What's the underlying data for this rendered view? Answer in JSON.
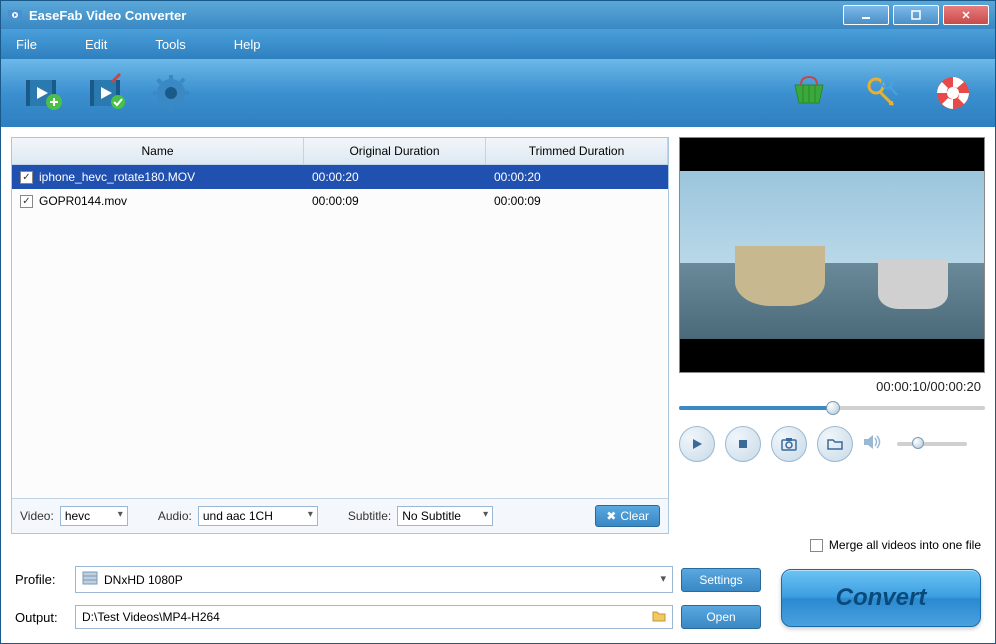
{
  "window": {
    "title": "EaseFab Video Converter"
  },
  "menu": {
    "items": [
      "File",
      "Edit",
      "Tools",
      "Help"
    ]
  },
  "table": {
    "headers": {
      "name": "Name",
      "orig": "Original Duration",
      "trim": "Trimmed Duration"
    },
    "rows": [
      {
        "checked": true,
        "selected": true,
        "name": "iphone_hevc_rotate180.MOV",
        "orig": "00:00:20",
        "trim": "00:00:20"
      },
      {
        "checked": true,
        "selected": false,
        "name": "GOPR0144.mov",
        "orig": "00:00:09",
        "trim": "00:00:09"
      }
    ]
  },
  "streams": {
    "video_label": "Video:",
    "video_value": "hevc",
    "audio_label": "Audio:",
    "audio_value": "und aac 1CH",
    "subtitle_label": "Subtitle:",
    "subtitle_value": "No Subtitle",
    "clear_label": "Clear"
  },
  "merge": {
    "label": "Merge all videos into one file",
    "checked": false
  },
  "preview": {
    "time_current": "00:00:10",
    "time_total": "00:00:20",
    "progress_pct": 50
  },
  "bottom": {
    "profile_label": "Profile:",
    "profile_value": "DNxHD 1080P",
    "settings_label": "Settings",
    "output_label": "Output:",
    "output_value": "D:\\Test Videos\\MP4-H264",
    "open_label": "Open",
    "convert_label": "Convert"
  }
}
